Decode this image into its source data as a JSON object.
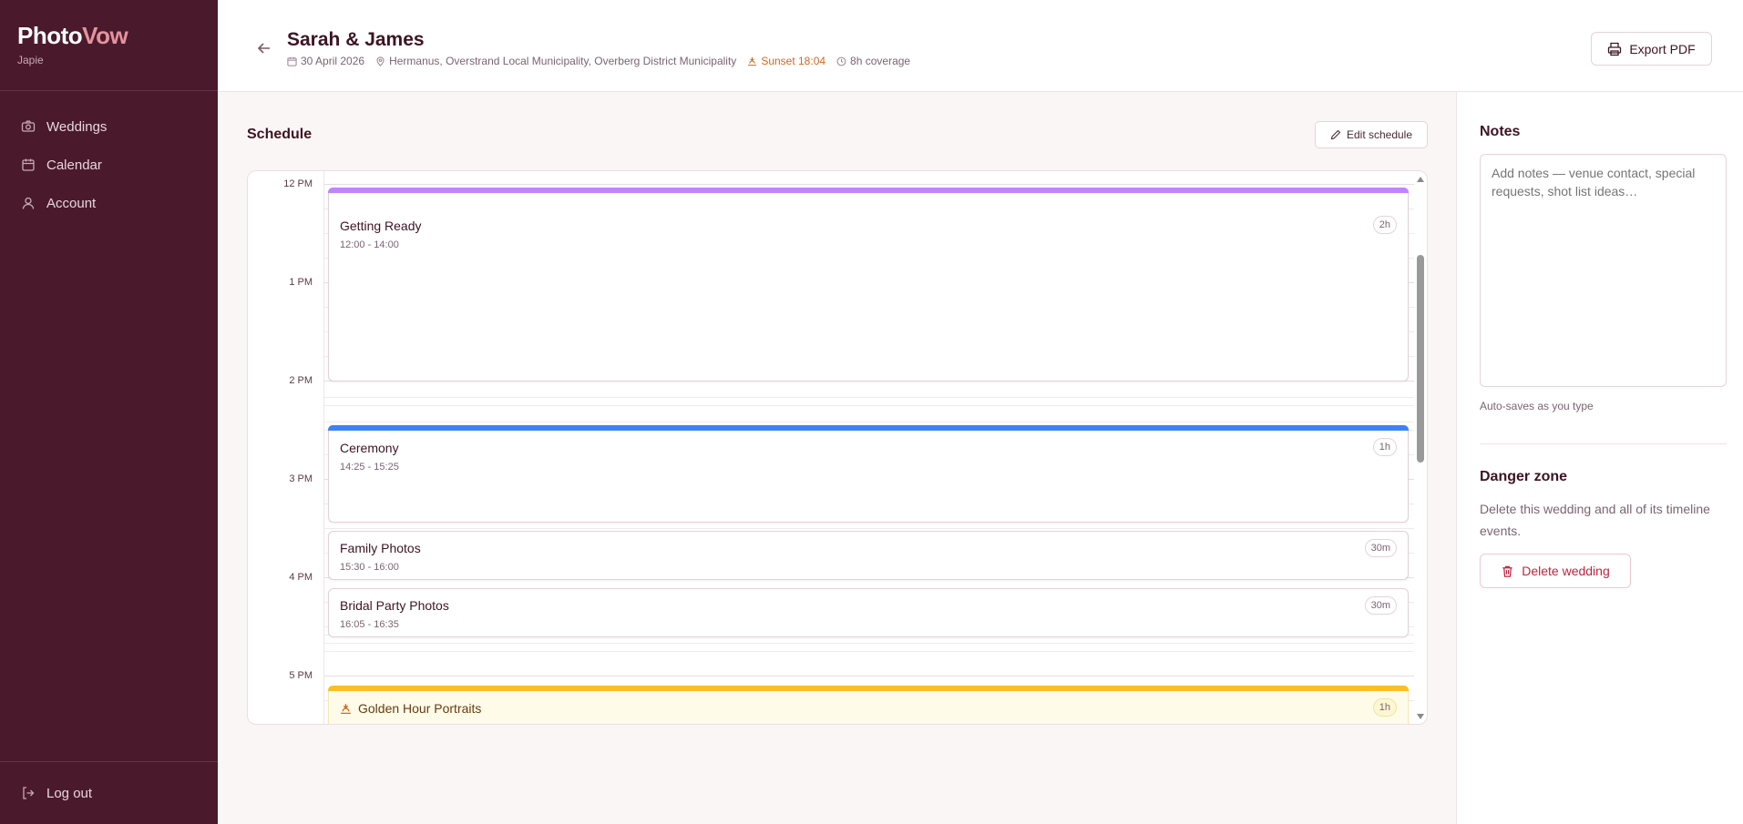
{
  "brand": {
    "part1": "Photo",
    "part2": "Vow",
    "user": "Japie"
  },
  "nav": {
    "weddings": "Weddings",
    "calendar": "Calendar",
    "account": "Account",
    "logout": "Log out"
  },
  "header": {
    "title": "Sarah & James",
    "date": "30 April 2026",
    "location": "Hermanus, Overstrand Local Municipality, Overberg District Municipality",
    "sunset": "Sunset 18:04",
    "coverage": "8h coverage",
    "export_label": "Export PDF"
  },
  "schedule": {
    "title": "Schedule",
    "edit_label": "Edit schedule",
    "hours": [
      "12 PM",
      "1 PM",
      "2 PM",
      "3 PM",
      "4 PM",
      "5 PM"
    ],
    "events": [
      {
        "name": "Getting Ready",
        "time": "12:00 - 14:00",
        "duration": "2h",
        "color": "#c084fc"
      },
      {
        "name": "Ceremony",
        "time": "14:25 - 15:25",
        "duration": "1h",
        "color": "#3b82f6"
      },
      {
        "name": "Family Photos",
        "time": "15:30 - 16:00",
        "duration": "30m",
        "color": ""
      },
      {
        "name": "Bridal Party Photos",
        "time": "16:05 - 16:35",
        "duration": "30m",
        "color": ""
      },
      {
        "name": "Golden Hour Portraits",
        "time": "",
        "duration": "1h",
        "color": "#fbbf24"
      }
    ]
  },
  "notes": {
    "title": "Notes",
    "placeholder": "Add notes — venue contact, special requests, shot list ideas…",
    "autosave": "Auto-saves as you type"
  },
  "danger": {
    "title": "Danger zone",
    "description": "Delete this wedding and all of its timeline events.",
    "delete_label": "Delete wedding"
  },
  "colors": {
    "sidebar_bg": "#4a1a2c",
    "brand_accent": "#e3939f",
    "sunset": "#d6661f",
    "danger": "#c0233f"
  }
}
